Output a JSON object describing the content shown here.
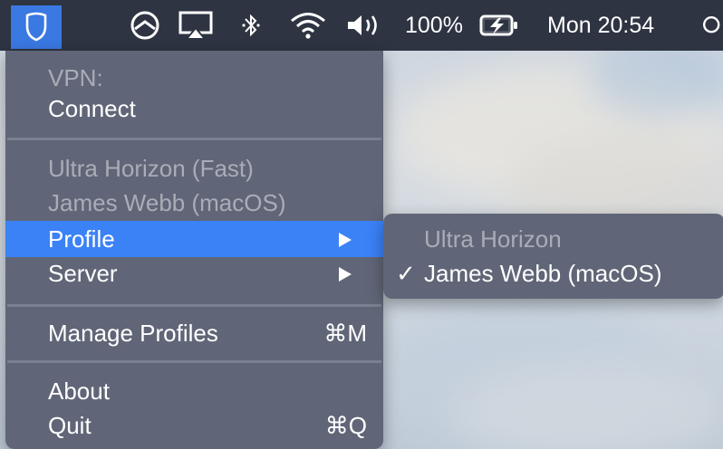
{
  "menubar": {
    "battery_percent": "100%",
    "clock": "Mon 20:54",
    "icons": [
      "vpn-shield-icon",
      "sync-circle-icon",
      "airplay-icon",
      "bluetooth-icon",
      "wifi-icon",
      "volume-icon",
      "battery-charging-icon",
      "search-icon"
    ]
  },
  "menu": {
    "vpn_header": "VPN:",
    "connect": "Connect",
    "recent_profiles": [
      "Ultra Horizon (Fast)",
      "James Webb (macOS)"
    ],
    "profile": "Profile",
    "server": "Server",
    "manage_profiles": "Manage Profiles",
    "manage_profiles_shortcut": "⌘M",
    "about": "About",
    "quit": "Quit",
    "quit_shortcut": "⌘Q"
  },
  "submenu": {
    "items": [
      {
        "label": "Ultra Horizon",
        "checked": false,
        "enabled": false
      },
      {
        "label": "James Webb (macOS)",
        "checked": true,
        "enabled": true
      }
    ],
    "check_glyph": "✓"
  },
  "colors": {
    "menubar_bg": "#2e3442",
    "menu_bg": "#606677",
    "highlight": "#3b82f7",
    "vpn_icon_bg": "#3a78e2",
    "disabled_text": "#a9adb8"
  }
}
